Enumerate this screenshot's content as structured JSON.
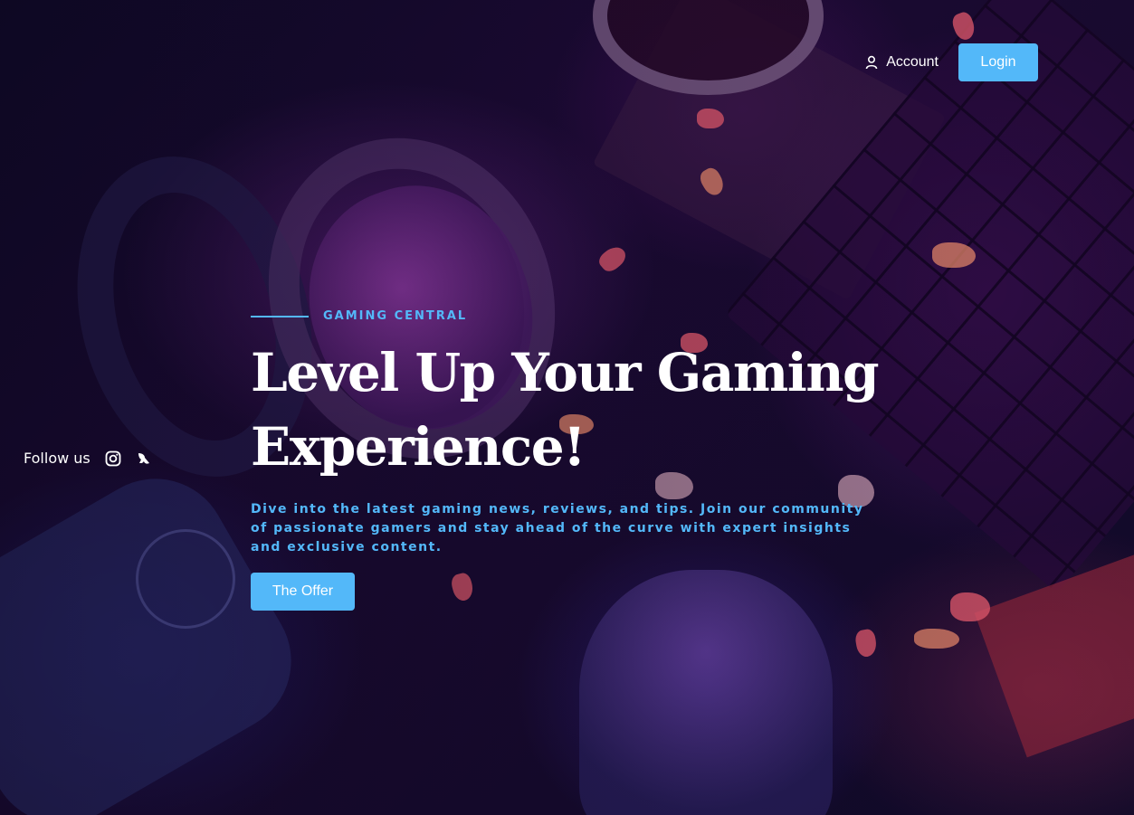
{
  "header": {
    "account_label": "Account",
    "login_label": "Login"
  },
  "social": {
    "follow_label": "Follow us",
    "icons": [
      "instagram-icon",
      "brand-icon"
    ]
  },
  "hero": {
    "eyebrow": "GAMING CENTRAL",
    "title_line1": "Level Up Your Gaming",
    "title_line2": "Experience!",
    "description": "Dive into the latest gaming news, reviews, and tips. Join our community of passionate gamers and stay ahead of the curve with expert insights and exclusive content.",
    "cta_label": "The Offer"
  },
  "colors": {
    "accent": "#53b8f9",
    "text": "#ffffff",
    "background": "#1d0a35"
  }
}
